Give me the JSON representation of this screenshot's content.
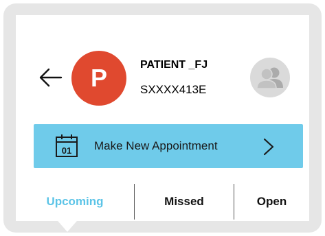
{
  "patient": {
    "initial": "P",
    "name": "PATIENT _FJ",
    "id": "SXXXX413E"
  },
  "appointment": {
    "label": "Make New Appointment",
    "calendar_day": "01"
  },
  "tabs": [
    {
      "label": "Upcoming",
      "active": true
    },
    {
      "label": "Missed",
      "active": false
    },
    {
      "label": "Open",
      "active": false
    }
  ],
  "colors": {
    "avatar": "#e0492f",
    "button": "#6fcbea",
    "active_tab": "#5cc4e7",
    "frame": "#e6e6e6"
  },
  "icons": {
    "back": "arrow-left-icon",
    "group": "group-icon",
    "calendar": "calendar-icon",
    "chevron": "chevron-right-icon"
  }
}
